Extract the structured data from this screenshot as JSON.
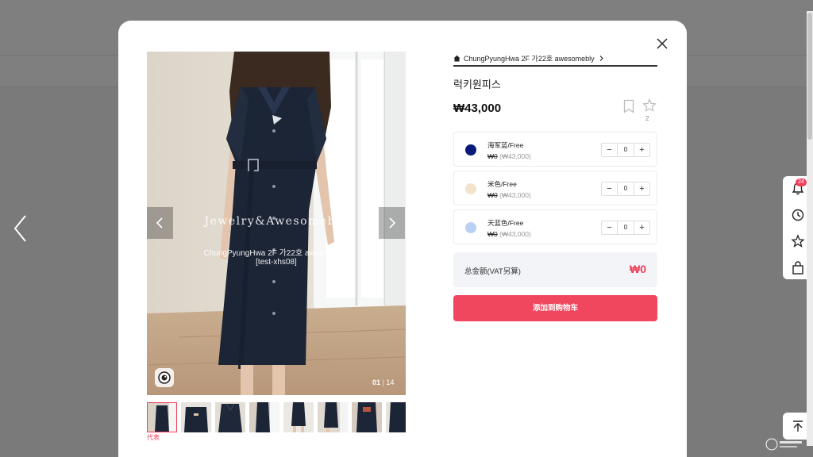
{
  "modal": {
    "store_name": "ChungPyungHwa 2F 가22호 awesomebly",
    "product_name": "럭키원피스",
    "price": "₩43,000",
    "favorite_count": "2",
    "main_image": {
      "watermark_title": "Jewelry&Awesomebly",
      "watermark_store": "ChungPyungHwa 2F 가22호 awesomebly",
      "watermark_code": "[test-xhs08]",
      "counter_current": "01",
      "counter_sep": "|",
      "counter_total": "14"
    },
    "thumbnail_caption": "代表",
    "options": [
      {
        "name": "海军蓝/Free",
        "price": "₩0",
        "orig_price": "(₩43,000)",
        "qty": "0",
        "color": "#0a1a7a"
      },
      {
        "name": "米色/Free",
        "price": "₩0",
        "orig_price": "(₩43,000)",
        "qty": "0",
        "color": "#f3e3cc"
      },
      {
        "name": "天蓝色/Free",
        "price": "₩0",
        "orig_price": "(₩43,000)",
        "qty": "0",
        "color": "#b9d0f5"
      }
    ],
    "stepper_minus": "−",
    "stepper_plus": "+",
    "total_label": "总金额(VAT另算)",
    "total_value": "₩0",
    "add_to_cart_label": "添加到购物车"
  },
  "side_rail": {
    "notification_count": "24"
  },
  "colors": {
    "accent": "#f0405b",
    "dress": "#1c2536"
  }
}
